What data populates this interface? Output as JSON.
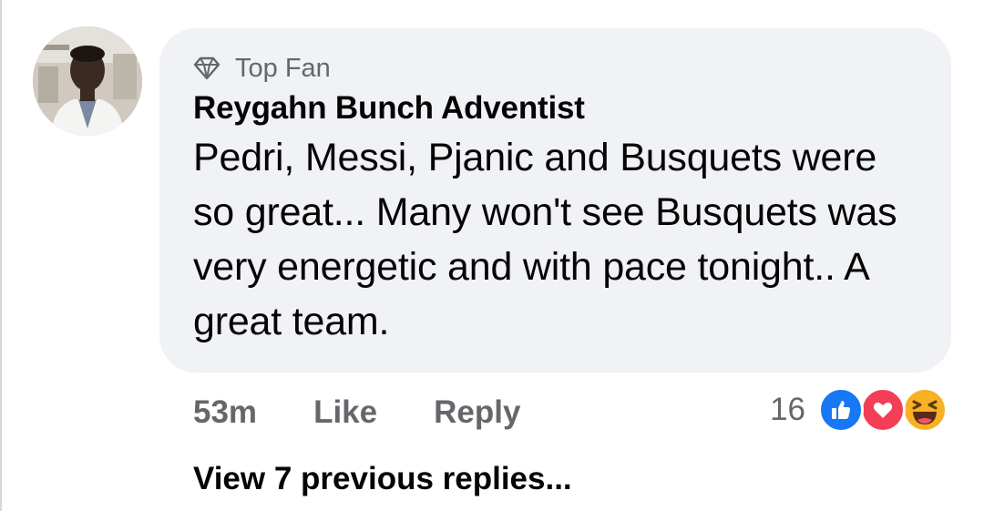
{
  "comment": {
    "badge_icon": "diamond-icon",
    "badge_label": "Top Fan",
    "author": "Reygahn Bunch Adventist",
    "text": "Pedri, Messi, Pjanic and Busquets were so great... Many won't see Busquets was very energetic and with pace tonight.. A great team.",
    "avatar_icon": "user-avatar"
  },
  "actions": {
    "time": "53m",
    "like_label": "Like",
    "reply_label": "Reply"
  },
  "reactions": {
    "count": "16",
    "icons": [
      "like-icon",
      "love-icon",
      "haha-icon"
    ]
  },
  "replies": {
    "view_previous_label": "View 7 previous replies..."
  },
  "colors": {
    "bubble_bg": "#f0f2f5",
    "secondary_text": "#65676b",
    "like_blue": "#1877f2",
    "love_red": "#f33e58",
    "haha_yellow": "#f7b125"
  }
}
